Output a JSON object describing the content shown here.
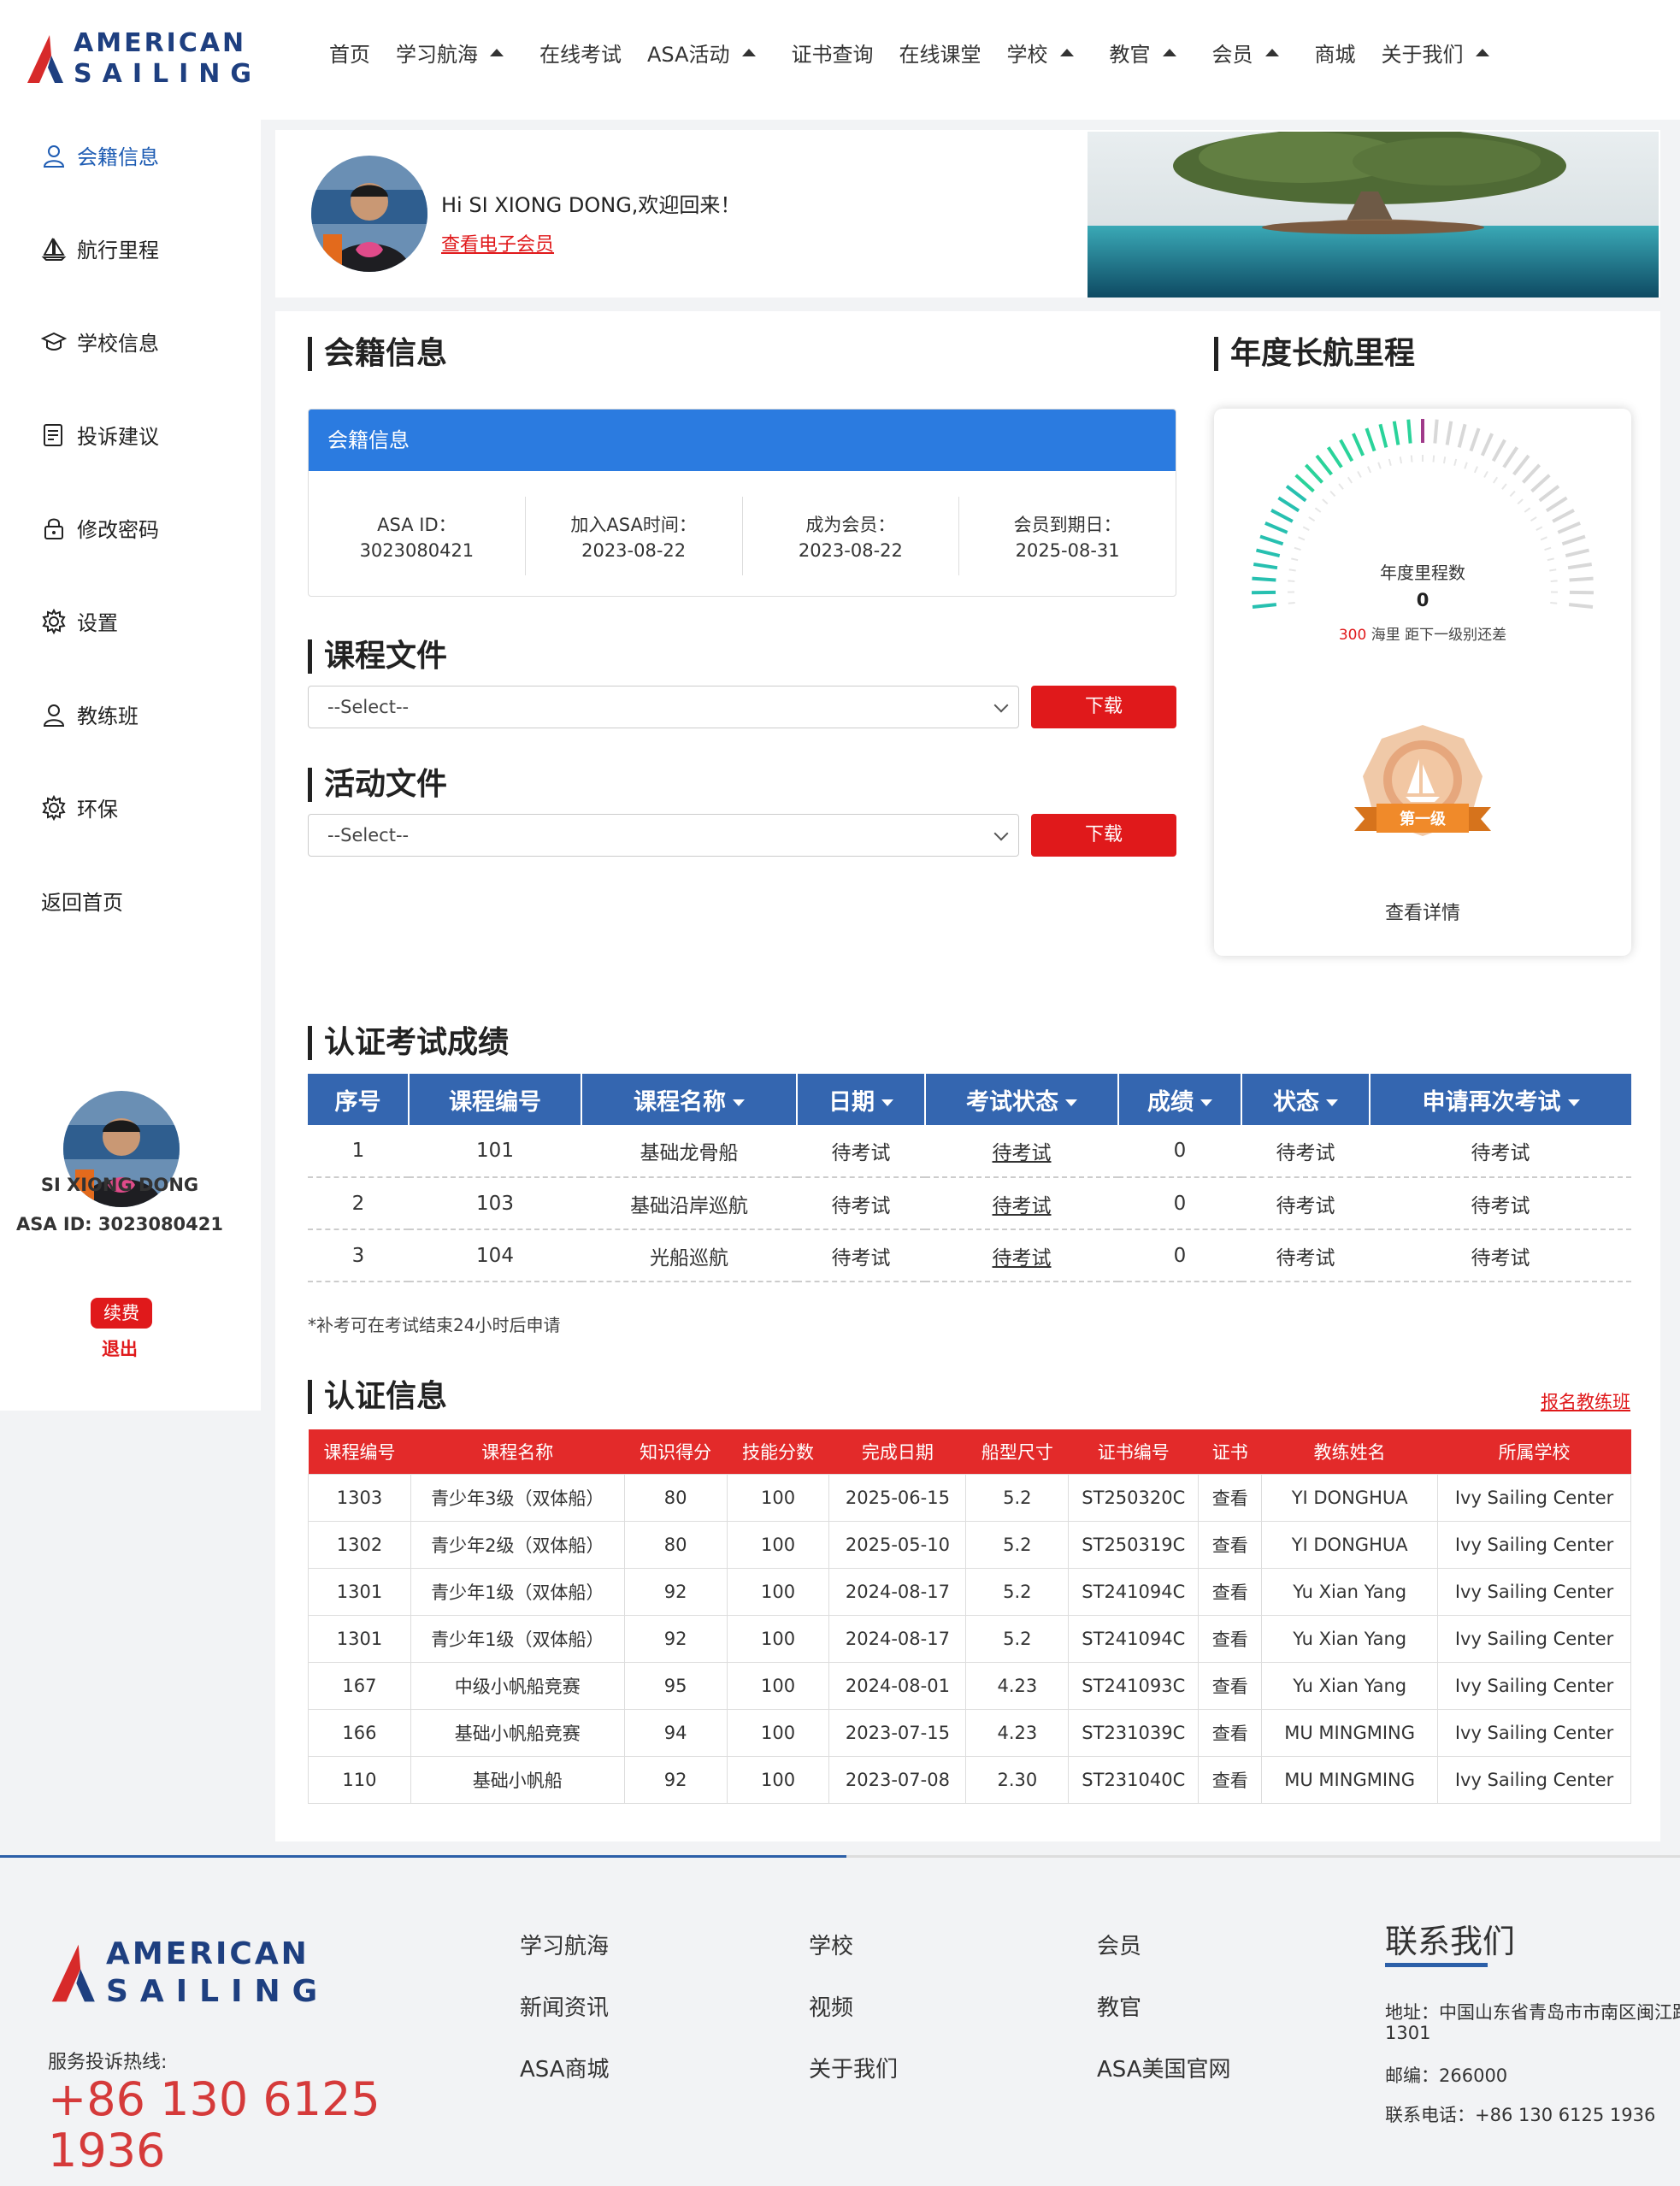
{
  "brand": {
    "line1": "AMERICAN",
    "line2": "SAILING"
  },
  "nav": [
    {
      "label": "首页",
      "caret": false
    },
    {
      "label": "学习航海",
      "caret": true
    },
    {
      "label": "在线考试",
      "caret": false
    },
    {
      "label": "ASA活动",
      "caret": true
    },
    {
      "label": "证书查询",
      "caret": false
    },
    {
      "label": "在线课堂",
      "caret": false
    },
    {
      "label": "学校",
      "caret": true
    },
    {
      "label": "教官",
      "caret": true
    },
    {
      "label": "会员",
      "caret": true
    },
    {
      "label": "商城",
      "caret": false
    },
    {
      "label": "关于我们",
      "caret": true
    }
  ],
  "sidebar": {
    "items": [
      {
        "label": "会籍信息",
        "icon": "user-icon",
        "active": true
      },
      {
        "label": "航行里程",
        "icon": "sailboat-icon",
        "active": false
      },
      {
        "label": "学校信息",
        "icon": "graduation-cap-icon",
        "active": false
      },
      {
        "label": "投诉建议",
        "icon": "feedback-icon",
        "active": false
      },
      {
        "label": "修改密码",
        "icon": "lock-icon",
        "active": false
      },
      {
        "label": "设置",
        "icon": "gear-icon",
        "active": false
      },
      {
        "label": "教练班",
        "icon": "user-icon",
        "active": false
      },
      {
        "label": "环保",
        "icon": "gear-icon",
        "active": false
      },
      {
        "label": "返回首页",
        "icon": "",
        "active": false
      }
    ],
    "user_name": "SI XIONG DONG",
    "asa_id": "ASA ID: 3023080421",
    "renew": "续费",
    "logout": "退出"
  },
  "welcome": {
    "greeting": "Hi SI XIONG DONG,欢迎回来！",
    "ecard_link": "查看电子会员"
  },
  "membership": {
    "section_title": "会籍信息",
    "box_title": "会籍信息",
    "fields": [
      {
        "label": "ASA ID：",
        "value": "3023080421"
      },
      {
        "label": "加入ASA时间：",
        "value": "2023-08-22"
      },
      {
        "label": "成为会员：",
        "value": "2023-08-22"
      },
      {
        "label": "会员到期日：",
        "value": "2025-08-31"
      }
    ]
  },
  "course_files": {
    "title": "课程文件",
    "select_value": "--Select--",
    "button": "下载"
  },
  "activity_files": {
    "title": "活动文件",
    "select_value": "--Select--",
    "button": "下载"
  },
  "mileage": {
    "title": "年度长航里程",
    "label": "年度里程数",
    "value": "0",
    "remaining": "300",
    "remaining_text": " 海里 距下一级别还差",
    "medal_level": "第一级",
    "details_link": "查看详情"
  },
  "exams": {
    "title": "认证考试成绩",
    "columns": [
      {
        "label": "序号",
        "sort": false
      },
      {
        "label": "课程编号",
        "sort": false
      },
      {
        "label": "课程名称",
        "sort": true
      },
      {
        "label": "日期",
        "sort": true
      },
      {
        "label": "考试状态",
        "sort": true
      },
      {
        "label": "成绩",
        "sort": true
      },
      {
        "label": "状态",
        "sort": true
      },
      {
        "label": "申请再次考试",
        "sort": true
      }
    ],
    "rows": [
      [
        "1",
        "101",
        "基础龙骨船",
        "待考试",
        "待考试",
        "0",
        "待考试",
        "待考试"
      ],
      [
        "2",
        "103",
        "基础沿岸巡航",
        "待考试",
        "待考试",
        "0",
        "待考试",
        "待考试"
      ],
      [
        "3",
        "104",
        "光船巡航",
        "待考试",
        "待考试",
        "0",
        "待考试",
        "待考试"
      ]
    ],
    "note": "*补考可在考试结束24小时后申请"
  },
  "certs": {
    "title": "认证信息",
    "enroll_link": "报名教练班",
    "columns": [
      "课程编号",
      "课程名称",
      "知识得分",
      "技能分数",
      "完成日期",
      "船型尺寸",
      "证书编号",
      "证书",
      "教练姓名",
      "所属学校"
    ],
    "rows": [
      [
        "1303",
        "青少年3级（双体船）",
        "80",
        "100",
        "2025-06-15",
        "5.2",
        "ST250320C",
        "查看",
        "YI DONGHUA",
        "Ivy Sailing Center"
      ],
      [
        "1302",
        "青少年2级（双体船）",
        "80",
        "100",
        "2025-05-10",
        "5.2",
        "ST250319C",
        "查看",
        "YI DONGHUA",
        "Ivy Sailing Center"
      ],
      [
        "1301",
        "青少年1级（双体船）",
        "92",
        "100",
        "2024-08-17",
        "5.2",
        "ST241094C",
        "查看",
        "Yu Xian Yang",
        "Ivy Sailing Center"
      ],
      [
        "1301",
        "青少年1级（双体船）",
        "92",
        "100",
        "2024-08-17",
        "5.2",
        "ST241094C",
        "查看",
        "Yu Xian Yang",
        "Ivy Sailing Center"
      ],
      [
        "167",
        "中级小帆船竞赛",
        "95",
        "100",
        "2024-08-01",
        "4.23",
        "ST241093C",
        "查看",
        "Yu Xian Yang",
        "Ivy Sailing Center"
      ],
      [
        "166",
        "基础小帆船竞赛",
        "94",
        "100",
        "2023-07-15",
        "4.23",
        "ST231039C",
        "查看",
        "MU MINGMING",
        "Ivy Sailing Center"
      ],
      [
        "110",
        "基础小帆船",
        "92",
        "100",
        "2023-07-08",
        "2.30",
        "ST231040C",
        "查看",
        "MU MINGMING",
        "Ivy Sailing Center"
      ]
    ]
  },
  "footer": {
    "hotline_label": "服务投诉热线:",
    "hotline": "+86 130 6125 1936",
    "links": [
      [
        "学习航海",
        "新闻资讯",
        "ASA商城"
      ],
      [
        "学校",
        "视频",
        "关于我们"
      ],
      [
        "会员",
        "教官",
        "ASA美国官网"
      ]
    ],
    "contact_title": "联系我们",
    "address": "地址：中国山东省青岛市市南区闽江路",
    "address2": "1301",
    "postcode": "邮编：266000",
    "phone": "联系电话：+86 130 6125 1936"
  },
  "colors": {
    "brand_blue": "#1e3f80",
    "accent_red": "#e0191b",
    "table_blue": "#3466b0",
    "box_blue": "#2b7be0"
  }
}
